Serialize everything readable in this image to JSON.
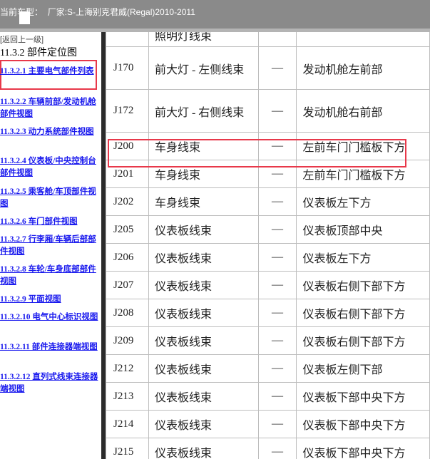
{
  "topbar": {
    "label": "当前车型：",
    "model": "厂家:S-上海别克君威(Regal)2010-2011"
  },
  "sidebar": {
    "back_link": "[返回上一级]",
    "section_title": "11.3.2 部件定位图",
    "items": [
      {
        "label": "11.3.2.1 主要电气部件列表"
      },
      {
        "label": "11.3.2.2 车辆前部/发动机舱部件视图"
      },
      {
        "label": "11.3.2.3 动力系统部件视图"
      },
      {
        "label": "11.3.2.4 仪表板/中央控制台部件视图"
      },
      {
        "label": "11.3.2.5 乘客舱/车顶部件视图"
      },
      {
        "label": "11.3.2.6 车门部件视图"
      },
      {
        "label": "11.3.2.7 行李厢/车辆后部部件视图"
      },
      {
        "label": "11.3.2.8 车轮/车身底部部件视图"
      },
      {
        "label": "11.3.2.9 平面视图"
      },
      {
        "label": "11.3.2.10 电气中心标识视图"
      },
      {
        "label": "11.3.2.11 部件连接器端视图"
      },
      {
        "label": "11.3.2.12 直列式线束连接器端视图"
      }
    ]
  },
  "table": {
    "rows": [
      {
        "id": "",
        "name": "照明灯线束",
        "option": "",
        "location": ""
      },
      {
        "id": "J170",
        "name": "前大灯 - 左侧线束",
        "option": "—",
        "location": "发动机舱左前部"
      },
      {
        "id": "J172",
        "name": "前大灯 - 右侧线束",
        "option": "—",
        "location": "发动机舱右前部"
      },
      {
        "id": "J200",
        "name": "车身线束",
        "option": "—",
        "location": "左前车门门槛板下方"
      },
      {
        "id": "J201",
        "name": "车身线束",
        "option": "—",
        "location": "左前车门门槛板下方"
      },
      {
        "id": "J202",
        "name": "车身线束",
        "option": "—",
        "location": "仪表板左下方"
      },
      {
        "id": "J205",
        "name": "仪表板线束",
        "option": "—",
        "location": "仪表板顶部中央"
      },
      {
        "id": "J206",
        "name": "仪表板线束",
        "option": "—",
        "location": "仪表板左下方"
      },
      {
        "id": "J207",
        "name": "仪表板线束",
        "option": "—",
        "location": "仪表板右侧下部下方"
      },
      {
        "id": "J208",
        "name": "仪表板线束",
        "option": "—",
        "location": "仪表板右侧下部下方"
      },
      {
        "id": "J209",
        "name": "仪表板线束",
        "option": "—",
        "location": "仪表板右侧下部下方"
      },
      {
        "id": "J212",
        "name": "仪表板线束",
        "option": "—",
        "location": "仪表板左侧下部"
      },
      {
        "id": "J213",
        "name": "仪表板线束",
        "option": "—",
        "location": "仪表板下部中央下方"
      },
      {
        "id": "J214",
        "name": "仪表板线束",
        "option": "—",
        "location": "仪表板下部中央下方"
      },
      {
        "id": "J215",
        "name": "仪表板线束",
        "option": "—",
        "location": "仪表板下部中央下方"
      }
    ]
  },
  "colors": {
    "highlight": "#e8384a",
    "link": "#1a1aee",
    "topbar": "#8a8a8a"
  }
}
